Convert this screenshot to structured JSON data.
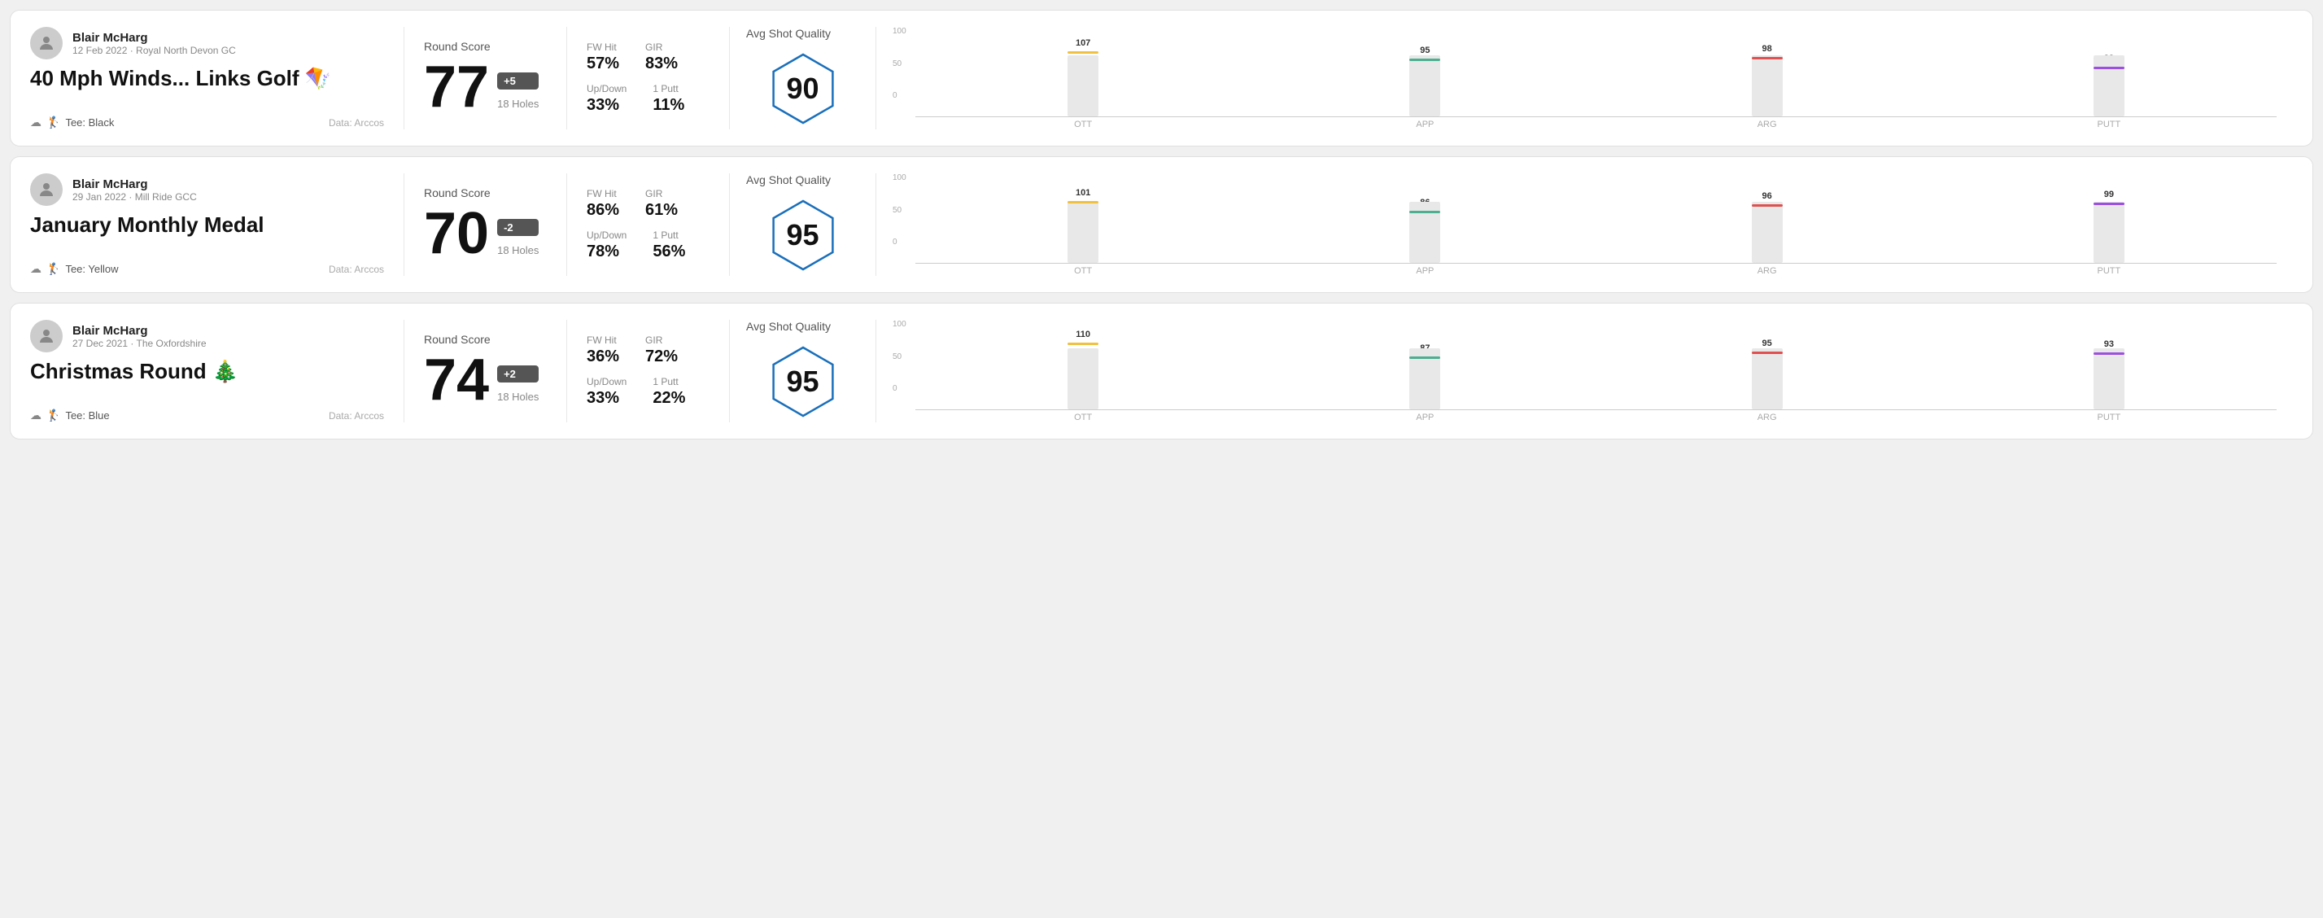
{
  "rounds": [
    {
      "id": "round1",
      "user_name": "Blair McHarg",
      "user_meta": "12 Feb 2022 · Royal North Devon GC",
      "title": "40 Mph Winds... Links Golf 🪁",
      "tee": "Tee: Black",
      "data_source": "Data: Arccos",
      "score": "77",
      "score_diff": "+5",
      "score_diff_sign": "positive",
      "holes": "18 Holes",
      "fw_hit": "57%",
      "gir": "83%",
      "up_down": "33%",
      "one_putt": "11%",
      "avg_quality": "90",
      "chart": {
        "bars": [
          {
            "label": "OTT",
            "value": 107,
            "color": "#f0c040",
            "max": 120
          },
          {
            "label": "APP",
            "value": 95,
            "color": "#4caf90",
            "max": 120
          },
          {
            "label": "ARG",
            "value": 98,
            "color": "#e05050",
            "max": 120
          },
          {
            "label": "PUTT",
            "value": 82,
            "color": "#9c50e0",
            "max": 120
          }
        ],
        "y_labels": [
          "100",
          "50",
          "0"
        ]
      }
    },
    {
      "id": "round2",
      "user_name": "Blair McHarg",
      "user_meta": "29 Jan 2022 · Mill Ride GCC",
      "title": "January Monthly Medal",
      "tee": "Tee: Yellow",
      "data_source": "Data: Arccos",
      "score": "70",
      "score_diff": "-2",
      "score_diff_sign": "negative",
      "holes": "18 Holes",
      "fw_hit": "86%",
      "gir": "61%",
      "up_down": "78%",
      "one_putt": "56%",
      "avg_quality": "95",
      "chart": {
        "bars": [
          {
            "label": "OTT",
            "value": 101,
            "color": "#f0c040",
            "max": 120
          },
          {
            "label": "APP",
            "value": 86,
            "color": "#4caf90",
            "max": 120
          },
          {
            "label": "ARG",
            "value": 96,
            "color": "#e05050",
            "max": 120
          },
          {
            "label": "PUTT",
            "value": 99,
            "color": "#9c50e0",
            "max": 120
          }
        ],
        "y_labels": [
          "100",
          "50",
          "0"
        ]
      }
    },
    {
      "id": "round3",
      "user_name": "Blair McHarg",
      "user_meta": "27 Dec 2021 · The Oxfordshire",
      "title": "Christmas Round 🎄",
      "tee": "Tee: Blue",
      "data_source": "Data: Arccos",
      "score": "74",
      "score_diff": "+2",
      "score_diff_sign": "positive",
      "holes": "18 Holes",
      "fw_hit": "36%",
      "gir": "72%",
      "up_down": "33%",
      "one_putt": "22%",
      "avg_quality": "95",
      "chart": {
        "bars": [
          {
            "label": "OTT",
            "value": 110,
            "color": "#f0c040",
            "max": 120
          },
          {
            "label": "APP",
            "value": 87,
            "color": "#4caf90",
            "max": 120
          },
          {
            "label": "ARG",
            "value": 95,
            "color": "#e05050",
            "max": 120
          },
          {
            "label": "PUTT",
            "value": 93,
            "color": "#9c50e0",
            "max": 120
          }
        ],
        "y_labels": [
          "100",
          "50",
          "0"
        ]
      }
    }
  ],
  "labels": {
    "round_score": "Round Score",
    "fw_hit": "FW Hit",
    "gir": "GIR",
    "up_down": "Up/Down",
    "one_putt": "1 Putt",
    "avg_shot_quality": "Avg Shot Quality"
  }
}
